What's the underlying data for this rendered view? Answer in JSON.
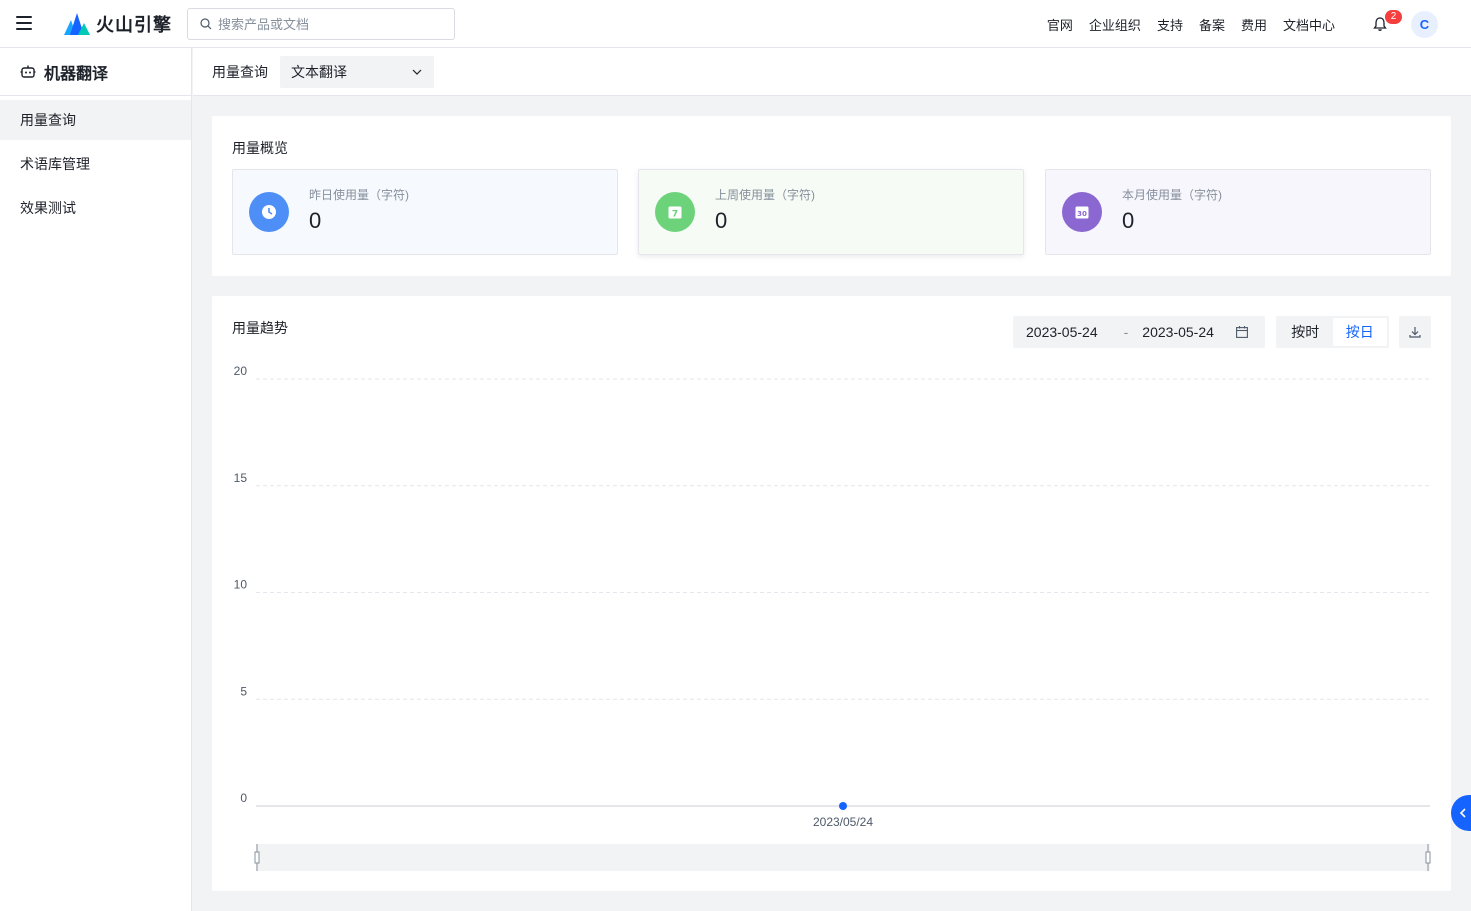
{
  "header": {
    "brand": "火山引擎",
    "search_placeholder": "搜索产品或文档",
    "nav": [
      "官网",
      "企业组织",
      "支持",
      "备案",
      "费用",
      "文档中心"
    ],
    "notification_count": "2",
    "avatar_letter": "C"
  },
  "sidebar": {
    "title": "机器翻译",
    "items": [
      {
        "label": "用量查询",
        "active": true
      },
      {
        "label": "术语库管理",
        "active": false
      },
      {
        "label": "效果测试",
        "active": false
      }
    ]
  },
  "subheader": {
    "label": "用量查询",
    "select_value": "文本翻译"
  },
  "overview": {
    "title": "用量概览",
    "stats": [
      {
        "label": "昨日使用量（字符)",
        "value": "0",
        "color": "#4e8ef7",
        "bg": "#f6f9fe",
        "icon": "clock-icon"
      },
      {
        "label": "上周使用量（字符)",
        "value": "0",
        "color": "#6cd37a",
        "bg": "#f6fbf5",
        "icon": "calendar-7-icon",
        "icon_text": "7"
      },
      {
        "label": "本月使用量（字符)",
        "value": "0",
        "color": "#8a67d1",
        "bg": "#f6f6fc",
        "icon": "calendar-30-icon",
        "icon_text": "30"
      }
    ]
  },
  "trend": {
    "title": "用量趋势",
    "date_start": "2023-05-24",
    "date_sep": "-",
    "date_end": "2023-05-24",
    "granularity": [
      "按时",
      "按日"
    ],
    "granularity_selected": "按日"
  },
  "chart_data": {
    "type": "line",
    "x": [
      "2023/05/24"
    ],
    "series": [
      {
        "values": [
          0
        ]
      }
    ],
    "yticks": [
      0,
      5,
      10,
      15,
      20
    ],
    "ylim": [
      0,
      20
    ],
    "grid": true,
    "color": "#1664ff"
  }
}
